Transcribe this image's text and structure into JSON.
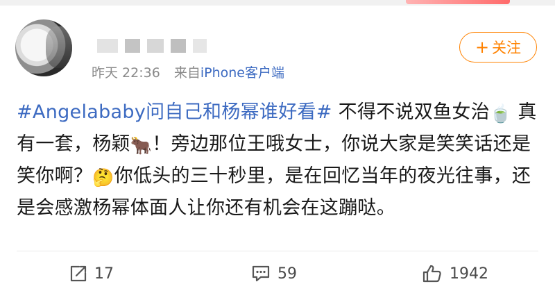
{
  "post": {
    "author": {
      "name_visible": "",
      "timestamp": "昨天 22:36",
      "source_prefix": "来自",
      "source_link": "iPhone客户端"
    },
    "follow_label": "关注",
    "follow_icon": "plus-icon",
    "content": {
      "hashtag": "#Angelababy问自己和杨幂谁好看#",
      "seg1": " 不得不说双鱼女治",
      "emoji_tea": "🍵",
      "seg2": " 真有一套，杨颖",
      "emoji_cow": "🐂",
      "seg3": "！旁边那位王哦女士，你说大家是笑笑话还是笑你啊？",
      "emoji_think": "🤔",
      "seg4": "你低头的三十秒里，是在回忆当年的夜光往事，还是会感激杨幂体面人让你还有机会在这蹦哒。"
    },
    "actions": {
      "repost": {
        "icon": "repost-icon",
        "count": "17"
      },
      "comment": {
        "icon": "comment-icon",
        "count": "59"
      },
      "like": {
        "icon": "thumbs-up-icon",
        "count": "1942"
      }
    },
    "colors": {
      "accent": "#ff8200",
      "link": "#3c6ac1",
      "meta": "#8a8a8a"
    }
  }
}
